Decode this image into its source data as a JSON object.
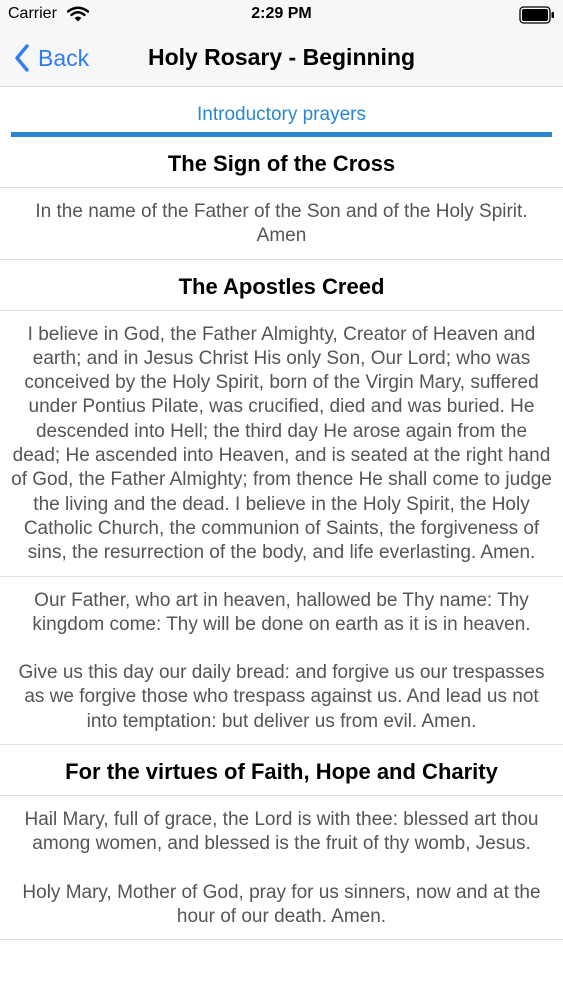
{
  "status_bar": {
    "carrier": "Carrier",
    "time": "2:29 PM"
  },
  "nav": {
    "back_label": "Back",
    "title": "Holy Rosary - Beginning"
  },
  "section_tab": {
    "label": "Introductory prayers"
  },
  "prayers": [
    {
      "title": "The Sign of the Cross",
      "paragraphs": [
        "In the name of the Father of the Son and of the Holy Spirit. Amen"
      ]
    },
    {
      "title": "The Apostles Creed",
      "paragraphs": [
        "I believe in God, the Father Almighty, Creator of Heaven and earth; and in Jesus Christ His only Son, Our Lord; who was conceived by the Holy Spirit, born of the Virgin Mary, suffered under Pontius Pilate, was crucified, died and was buried. He descended into Hell; the third day He arose again from the dead; He ascended into Heaven, and is seated at the right hand of God, the Father Almighty; from thence He shall come to judge the living and the dead. I believe in the Holy Spirit, the Holy Catholic Church, the communion of Saints, the forgiveness of sins, the resurrection of the body, and life everlasting. Amen."
      ]
    },
    {
      "title": "",
      "paragraphs": [
        "Our Father, who art in heaven, hallowed be Thy name: Thy kingdom come: Thy will be done on earth as it is in heaven.",
        "Give us this day our daily bread: and forgive us our trespasses as we forgive those who trespass against us. And lead us not into temptation: but deliver us from evil. Amen."
      ]
    },
    {
      "title": "For the virtues of Faith, Hope and Charity",
      "paragraphs": [
        "Hail Mary, full of grace, the Lord is with thee: blessed art thou among women, and blessed is the fruit of thy womb, Jesus.",
        "Holy Mary, Mother of God, pray for us sinners, now and at the hour of our death. Amen."
      ]
    }
  ],
  "colors": {
    "accent": "#2a86d0",
    "nav_link": "#2e7cf6",
    "body_text": "#555555"
  }
}
